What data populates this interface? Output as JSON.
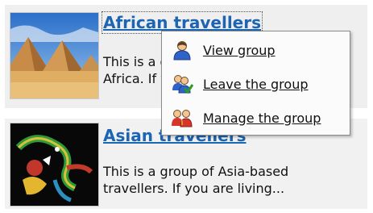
{
  "groups": [
    {
      "title": "African travellers",
      "description_line1": "This is a group of Africa-based",
      "description_line2": "Africa. If you are living...",
      "image": "pyramids-photo"
    },
    {
      "title": "Asian travellers",
      "description_line1": "This is a group of Asia-based",
      "description_line2": "travellers. If you are living...",
      "image": "chinese-dragon-photo"
    }
  ],
  "context_menu": {
    "items": [
      {
        "label": "View group",
        "icon": "user-icon"
      },
      {
        "label": "Leave the group",
        "icon": "users-check-icon"
      },
      {
        "label": "Manage the group",
        "icon": "users-manage-icon"
      }
    ]
  },
  "colors": {
    "link": "#1c64b4",
    "card_bg": "#efefef",
    "menu_border": "#8a8a8a"
  }
}
